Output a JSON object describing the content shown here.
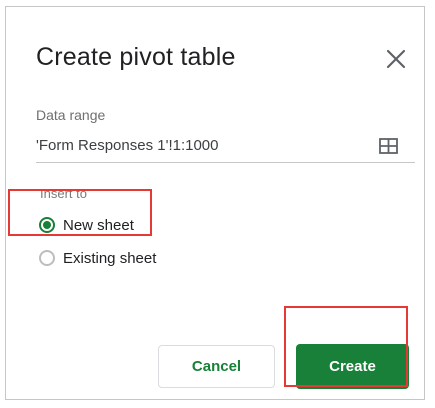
{
  "dialog": {
    "title": "Create pivot table",
    "close_icon": "close-icon",
    "data_range_label": "Data range",
    "data_range_value": "'Form Responses 1'!1:1000",
    "grid_icon": "grid-select-icon",
    "insert_to_label": "Insert to",
    "options": [
      {
        "label": "New sheet",
        "selected": true
      },
      {
        "label": "Existing sheet",
        "selected": false
      }
    ],
    "cancel_label": "Cancel",
    "create_label": "Create"
  },
  "colors": {
    "accent": "#188038",
    "highlight": "#e53935"
  }
}
